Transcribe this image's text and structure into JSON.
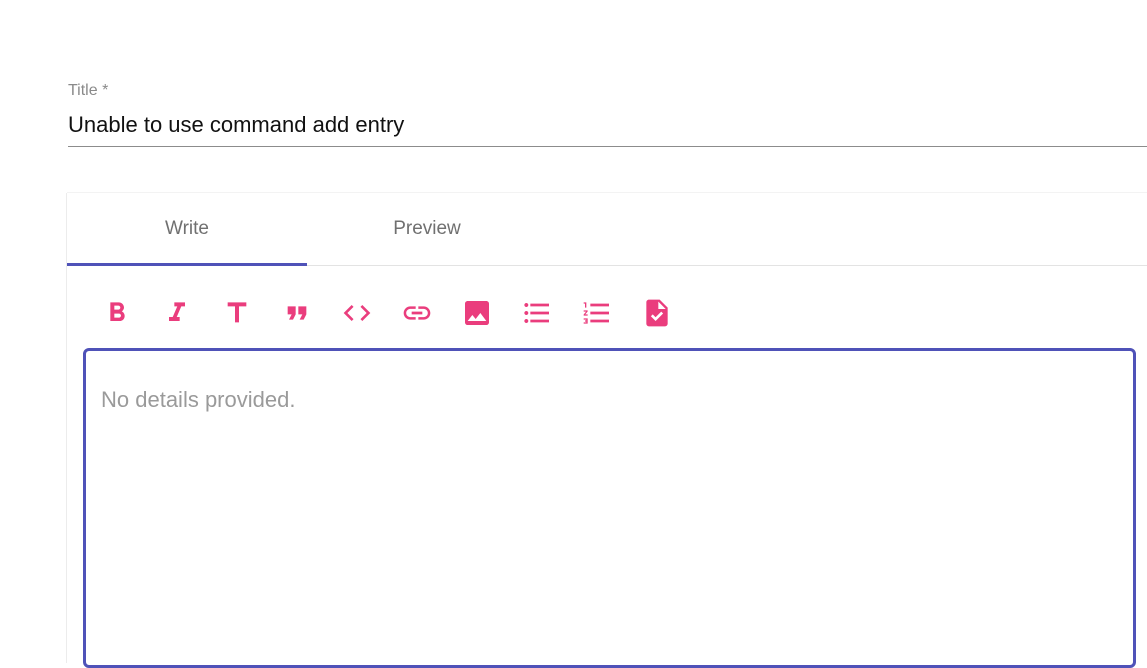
{
  "title_field": {
    "label": "Title *",
    "value": "Unable to use command add entry"
  },
  "editor": {
    "tabs": [
      {
        "label": "Write",
        "active": true
      },
      {
        "label": "Preview",
        "active": false
      }
    ],
    "toolbar": [
      {
        "icon": "bold-icon"
      },
      {
        "icon": "italic-icon"
      },
      {
        "icon": "heading-icon"
      },
      {
        "icon": "quote-icon"
      },
      {
        "icon": "code-icon"
      },
      {
        "icon": "link-icon"
      },
      {
        "icon": "image-icon"
      },
      {
        "icon": "bulleted-list-icon"
      },
      {
        "icon": "numbered-list-icon"
      },
      {
        "icon": "task-list-icon"
      }
    ],
    "details_placeholder": "No details provided.",
    "details_value": ""
  },
  "colors": {
    "accent": "#4f52b8",
    "icon": "#ea3d7d",
    "label": "#8a8a8a"
  }
}
